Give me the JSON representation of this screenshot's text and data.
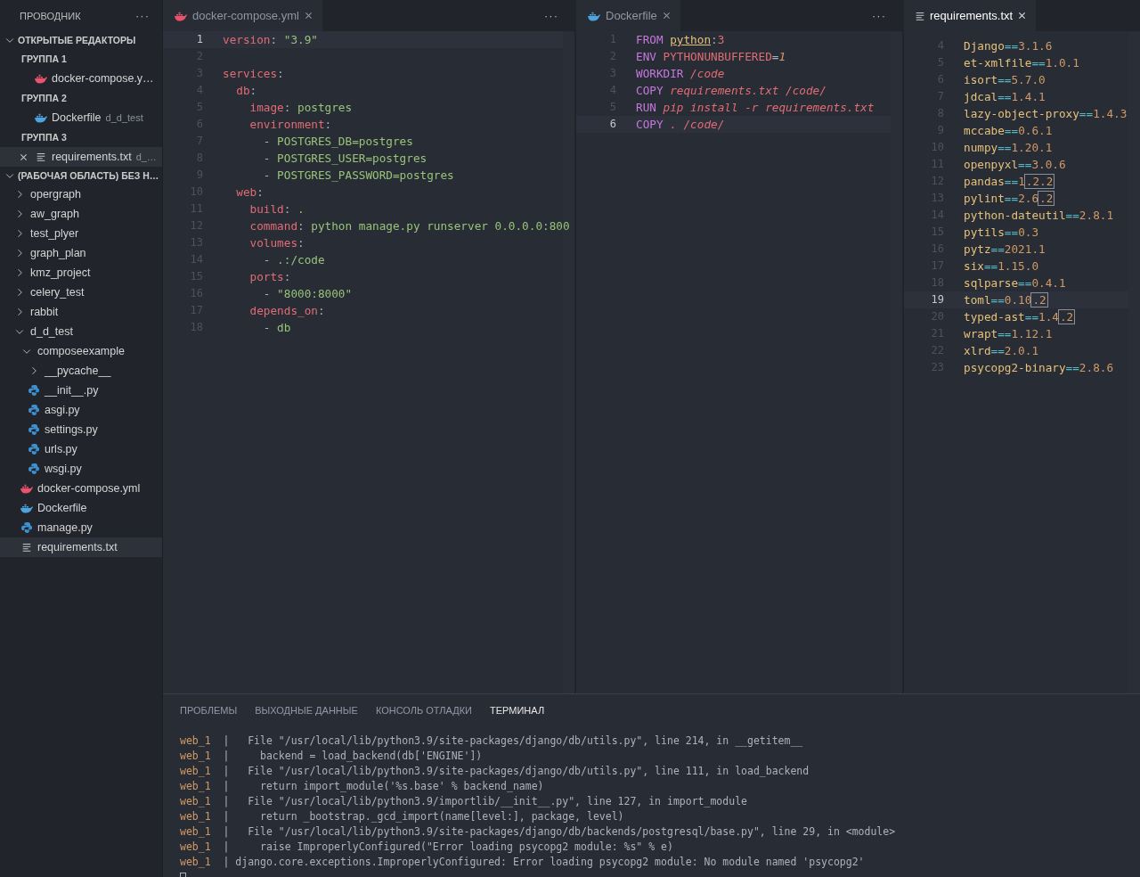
{
  "sidebar": {
    "title": "ПРОВОДНИК",
    "more": "···",
    "open_editors": {
      "title": "ОТКРЫТЫЕ РЕДАКТОРЫ",
      "expanded": true,
      "groups": [
        {
          "title": "ГРУППА 1",
          "files": [
            {
              "name": "docker-compose.y…",
              "kind": "compose",
              "selected": false
            }
          ]
        },
        {
          "title": "ГРУППА 2",
          "files": [
            {
              "name": "Dockerfile",
              "detail": "d_d_test",
              "kind": "docker",
              "selected": false
            }
          ]
        },
        {
          "title": "ГРУППА 3",
          "files": [
            {
              "name": "requirements.txt",
              "detail": "d_…",
              "kind": "text",
              "selected": true
            }
          ]
        }
      ]
    },
    "workspace": {
      "title": "(РАБОЧАЯ ОБЛАСТЬ) БЕЗ Н…",
      "expanded": true,
      "tree": [
        {
          "name": "opergraph",
          "kind": "folder",
          "expanded": false,
          "selected": false
        },
        {
          "name": "aw_graph",
          "kind": "folder",
          "expanded": false,
          "selected": false
        },
        {
          "name": "test_plyer",
          "kind": "folder",
          "expanded": false,
          "selected": false
        },
        {
          "name": "graph_plan",
          "kind": "folder",
          "expanded": false,
          "selected": false
        },
        {
          "name": "kmz_project",
          "kind": "folder",
          "expanded": false,
          "selected": false
        },
        {
          "name": "celery_test",
          "kind": "folder",
          "expanded": false,
          "selected": false
        },
        {
          "name": "rabbit",
          "kind": "folder",
          "expanded": false,
          "selected": false
        },
        {
          "name": "d_d_test",
          "kind": "folder",
          "expanded": true,
          "selected": false,
          "children": [
            {
              "name": "composeexample",
              "kind": "folder",
              "expanded": true,
              "selected": false,
              "children": [
                {
                  "name": "__pycache__",
                  "kind": "folder",
                  "expanded": false,
                  "selected": false
                },
                {
                  "name": "__init__.py",
                  "kind": "python",
                  "selected": false
                },
                {
                  "name": "asgi.py",
                  "kind": "python",
                  "selected": false
                },
                {
                  "name": "settings.py",
                  "kind": "python",
                  "selected": false
                },
                {
                  "name": "urls.py",
                  "kind": "python",
                  "selected": false
                },
                {
                  "name": "wsgi.py",
                  "kind": "python",
                  "selected": false
                }
              ]
            },
            {
              "name": "docker-compose.yml",
              "kind": "compose",
              "selected": false
            },
            {
              "name": "Dockerfile",
              "kind": "docker",
              "selected": false
            },
            {
              "name": "manage.py",
              "kind": "python",
              "selected": false
            },
            {
              "name": "requirements.txt",
              "kind": "text",
              "selected": true
            }
          ]
        }
      ]
    }
  },
  "editors": [
    {
      "focused": false,
      "more": "···",
      "tab": {
        "label": "docker-compose.yml",
        "kind": "compose"
      },
      "lines": [
        {
          "no": "1",
          "current": true,
          "tokens": [
            {
              "kind": "key",
              "text": "version"
            },
            {
              "kind": "punct",
              "text": ": "
            },
            {
              "kind": "str",
              "text": "\"3.9\""
            }
          ]
        },
        {
          "no": "2",
          "current": false
        },
        {
          "no": "3",
          "current": false,
          "tokens": [
            {
              "kind": "key",
              "text": "services"
            },
            {
              "kind": "punct",
              "text": ":"
            }
          ]
        },
        {
          "no": "4",
          "current": false,
          "tokens": [
            {
              "kind": "key",
              "text": "  db"
            },
            {
              "kind": "punct",
              "text": ":"
            }
          ]
        },
        {
          "no": "5",
          "current": false,
          "tokens": [
            {
              "kind": "key",
              "text": "    image"
            },
            {
              "kind": "punct",
              "text": ": "
            },
            {
              "kind": "str",
              "text": "postgres"
            }
          ]
        },
        {
          "no": "6",
          "current": false,
          "tokens": [
            {
              "kind": "key",
              "text": "    environment"
            },
            {
              "kind": "punct",
              "text": ":"
            }
          ]
        },
        {
          "no": "7",
          "current": false,
          "tokens": [
            {
              "kind": "punct",
              "text": "      - "
            },
            {
              "kind": "str",
              "text": "POSTGRES_DB=postgres"
            }
          ]
        },
        {
          "no": "8",
          "current": false,
          "tokens": [
            {
              "kind": "punct",
              "text": "      - "
            },
            {
              "kind": "str",
              "text": "POSTGRES_USER=postgres"
            }
          ]
        },
        {
          "no": "9",
          "current": false,
          "tokens": [
            {
              "kind": "punct",
              "text": "      - "
            },
            {
              "kind": "str",
              "text": "POSTGRES_PASSWORD=postgres"
            }
          ]
        },
        {
          "no": "10",
          "current": false,
          "tokens": [
            {
              "kind": "key",
              "text": "  web"
            },
            {
              "kind": "punct",
              "text": ":"
            }
          ]
        },
        {
          "no": "11",
          "current": false,
          "tokens": [
            {
              "kind": "key",
              "text": "    build"
            },
            {
              "kind": "punct",
              "text": ": "
            },
            {
              "kind": "str",
              "text": "."
            }
          ]
        },
        {
          "no": "12",
          "current": false,
          "tokens": [
            {
              "kind": "key",
              "text": "    command"
            },
            {
              "kind": "punct",
              "text": ": "
            },
            {
              "kind": "str",
              "text": "python manage.py runserver 0.0.0.0:800"
            }
          ]
        },
        {
          "no": "13",
          "current": false,
          "tokens": [
            {
              "kind": "key",
              "text": "    volumes"
            },
            {
              "kind": "punct",
              "text": ":"
            }
          ]
        },
        {
          "no": "14",
          "current": false,
          "tokens": [
            {
              "kind": "punct",
              "text": "      - "
            },
            {
              "kind": "str",
              "text": ".:/code"
            }
          ]
        },
        {
          "no": "15",
          "current": false,
          "tokens": [
            {
              "kind": "key",
              "text": "    ports"
            },
            {
              "kind": "punct",
              "text": ":"
            }
          ]
        },
        {
          "no": "16",
          "current": false,
          "tokens": [
            {
              "kind": "punct",
              "text": "      - "
            },
            {
              "kind": "str",
              "text": "\"8000:8000\""
            }
          ]
        },
        {
          "no": "17",
          "current": false,
          "tokens": [
            {
              "kind": "key",
              "text": "    depends_on"
            },
            {
              "kind": "punct",
              "text": ":"
            }
          ]
        },
        {
          "no": "18",
          "current": false,
          "tokens": [
            {
              "kind": "punct",
              "text": "      - "
            },
            {
              "kind": "str",
              "text": "db"
            }
          ]
        }
      ]
    },
    {
      "focused": false,
      "more": "···",
      "tab": {
        "label": "Dockerfile",
        "kind": "docker"
      },
      "lines": [
        {
          "no": "1",
          "current": false,
          "tokens": [
            {
              "kind": "kw",
              "text": "FROM "
            },
            {
              "kind": "link",
              "text": "python"
            },
            {
              "kind": "punct",
              "text": ":"
            },
            {
              "kind": "var",
              "text": "3"
            }
          ]
        },
        {
          "no": "2",
          "current": false,
          "tokens": [
            {
              "kind": "kw",
              "text": "ENV "
            },
            {
              "kind": "var",
              "text": "PYTHONUNBUFFERED"
            },
            {
              "kind": "punct",
              "text": "="
            },
            {
              "kind": "num",
              "text": "1"
            }
          ]
        },
        {
          "no": "3",
          "current": false,
          "tokens": [
            {
              "kind": "kw",
              "text": "WORKDIR "
            },
            {
              "kind": "arg",
              "text": "/code"
            }
          ]
        },
        {
          "no": "4",
          "current": false,
          "tokens": [
            {
              "kind": "kw",
              "text": "COPY "
            },
            {
              "kind": "arg",
              "text": "requirements.txt /code/"
            }
          ]
        },
        {
          "no": "5",
          "current": false,
          "tokens": [
            {
              "kind": "kw",
              "text": "RUN "
            },
            {
              "kind": "arg",
              "text": "pip install -r requirements.txt"
            }
          ]
        },
        {
          "no": "6",
          "current": true,
          "tokens": [
            {
              "kind": "kw",
              "text": "COPY "
            },
            {
              "kind": "arg",
              "text": ". /code/"
            }
          ]
        }
      ]
    },
    {
      "focused": true,
      "tab": {
        "label": "requirements.txt",
        "kind": "text"
      },
      "lines": [
        {
          "no": "4",
          "current": false,
          "tokens": [
            {
              "kind": "name",
              "text": "Django"
            },
            {
              "kind": "op",
              "text": "=="
            },
            {
              "kind": "ver",
              "text": "3.1.6"
            }
          ]
        },
        {
          "no": "5",
          "current": false,
          "tokens": [
            {
              "kind": "name",
              "text": "et-xmlfile"
            },
            {
              "kind": "op",
              "text": "=="
            },
            {
              "kind": "ver",
              "text": "1.0.1"
            }
          ]
        },
        {
          "no": "6",
          "current": false,
          "tokens": [
            {
              "kind": "name",
              "text": "isort"
            },
            {
              "kind": "op",
              "text": "=="
            },
            {
              "kind": "ver",
              "text": "5.7.0"
            }
          ]
        },
        {
          "no": "7",
          "current": false,
          "tokens": [
            {
              "kind": "name",
              "text": "jdcal"
            },
            {
              "kind": "op",
              "text": "=="
            },
            {
              "kind": "ver",
              "text": "1.4.1"
            }
          ]
        },
        {
          "no": "8",
          "current": false,
          "tokens": [
            {
              "kind": "name",
              "text": "lazy-object-proxy"
            },
            {
              "kind": "op",
              "text": "=="
            },
            {
              "kind": "ver",
              "text": "1.4.3"
            }
          ]
        },
        {
          "no": "9",
          "current": false,
          "tokens": [
            {
              "kind": "name",
              "text": "mccabe"
            },
            {
              "kind": "op",
              "text": "=="
            },
            {
              "kind": "ver",
              "text": "0.6.1"
            }
          ]
        },
        {
          "no": "10",
          "current": false,
          "tokens": [
            {
              "kind": "name",
              "text": "numpy"
            },
            {
              "kind": "op",
              "text": "=="
            },
            {
              "kind": "ver",
              "text": "1.20.1"
            }
          ]
        },
        {
          "no": "11",
          "current": false,
          "tokens": [
            {
              "kind": "name",
              "text": "openpyxl"
            },
            {
              "kind": "op",
              "text": "=="
            },
            {
              "kind": "ver",
              "text": "3.0.6"
            }
          ]
        },
        {
          "no": "12",
          "current": false,
          "tokens": [
            {
              "kind": "name",
              "text": "pandas"
            },
            {
              "kind": "op",
              "text": "=="
            },
            {
              "kind": "ver",
              "text": "1"
            },
            {
              "kind": "match",
              "text": ".2.2"
            }
          ]
        },
        {
          "no": "13",
          "current": false,
          "tokens": [
            {
              "kind": "name",
              "text": "pylint"
            },
            {
              "kind": "op",
              "text": "=="
            },
            {
              "kind": "ver",
              "text": "2.6"
            },
            {
              "kind": "match",
              "text": ".2"
            }
          ]
        },
        {
          "no": "14",
          "current": false,
          "tokens": [
            {
              "kind": "name",
              "text": "python-dateutil"
            },
            {
              "kind": "op",
              "text": "=="
            },
            {
              "kind": "ver",
              "text": "2.8.1"
            }
          ]
        },
        {
          "no": "15",
          "current": false,
          "tokens": [
            {
              "kind": "name",
              "text": "pytils"
            },
            {
              "kind": "op",
              "text": "=="
            },
            {
              "kind": "ver",
              "text": "0.3"
            }
          ]
        },
        {
          "no": "16",
          "current": false,
          "tokens": [
            {
              "kind": "name",
              "text": "pytz"
            },
            {
              "kind": "op",
              "text": "=="
            },
            {
              "kind": "ver",
              "text": "2021.1"
            }
          ]
        },
        {
          "no": "17",
          "current": false,
          "tokens": [
            {
              "kind": "name",
              "text": "six"
            },
            {
              "kind": "op",
              "text": "=="
            },
            {
              "kind": "ver",
              "text": "1.15.0"
            }
          ]
        },
        {
          "no": "18",
          "current": false,
          "tokens": [
            {
              "kind": "name",
              "text": "sqlparse"
            },
            {
              "kind": "op",
              "text": "=="
            },
            {
              "kind": "ver",
              "text": "0.4.1"
            }
          ]
        },
        {
          "no": "19",
          "current": true,
          "tokens": [
            {
              "kind": "name",
              "text": "toml"
            },
            {
              "kind": "op",
              "text": "=="
            },
            {
              "kind": "ver",
              "text": "0.10"
            },
            {
              "kind": "match",
              "text": ".2"
            }
          ]
        },
        {
          "no": "20",
          "current": false,
          "tokens": [
            {
              "kind": "name",
              "text": "typed-ast"
            },
            {
              "kind": "op",
              "text": "=="
            },
            {
              "kind": "ver",
              "text": "1.4"
            },
            {
              "kind": "match",
              "text": ".2"
            }
          ]
        },
        {
          "no": "21",
          "current": false,
          "tokens": [
            {
              "kind": "name",
              "text": "wrapt"
            },
            {
              "kind": "op",
              "text": "=="
            },
            {
              "kind": "ver",
              "text": "1.12.1"
            }
          ]
        },
        {
          "no": "22",
          "current": false,
          "tokens": [
            {
              "kind": "name",
              "text": "xlrd"
            },
            {
              "kind": "op",
              "text": "=="
            },
            {
              "kind": "ver",
              "text": "2.0.1"
            }
          ]
        },
        {
          "no": "23",
          "current": false,
          "tokens": [
            {
              "kind": "name",
              "text": "psycopg2-binary"
            },
            {
              "kind": "op",
              "text": "=="
            },
            {
              "kind": "ver",
              "text": "2.8.6"
            }
          ]
        }
      ]
    }
  ],
  "panel": {
    "tabs": [
      {
        "label": "ПРОБЛЕМЫ",
        "selected": false
      },
      {
        "label": "ВЫХОДНЫЕ ДАННЫЕ",
        "selected": false
      },
      {
        "label": "КОНСОЛЬ ОТЛАДКИ",
        "selected": false
      },
      {
        "label": "ТЕРМИНАЛ",
        "selected": true
      }
    ],
    "terminal": [
      {
        "service": "web_1",
        "sep": "|",
        "text": "   File \"/usr/local/lib/python3.9/site-packages/django/db/utils.py\", line 214, in __getitem__"
      },
      {
        "service": "web_1",
        "sep": "|",
        "text": "     backend = load_backend(db['ENGINE'])"
      },
      {
        "service": "web_1",
        "sep": "|",
        "text": "   File \"/usr/local/lib/python3.9/site-packages/django/db/utils.py\", line 111, in load_backend"
      },
      {
        "service": "web_1",
        "sep": "|",
        "text": "     return import_module('%s.base' % backend_name)"
      },
      {
        "service": "web_1",
        "sep": "|",
        "text": "   File \"/usr/local/lib/python3.9/importlib/__init__.py\", line 127, in import_module"
      },
      {
        "service": "web_1",
        "sep": "|",
        "text": "     return _bootstrap._gcd_import(name[level:], package, level)"
      },
      {
        "service": "web_1",
        "sep": "|",
        "text": "   File \"/usr/local/lib/python3.9/site-packages/django/db/backends/postgresql/base.py\", line 29, in <module>"
      },
      {
        "service": "web_1",
        "sep": "|",
        "text": "     raise ImproperlyConfigured(\"Error loading psycopg2 module: %s\" % e)"
      },
      {
        "service": "web_1",
        "sep": "|",
        "text": " django.core.exceptions.ImproperlyConfigured: Error loading psycopg2 module: No module named 'psycopg2'"
      }
    ]
  }
}
